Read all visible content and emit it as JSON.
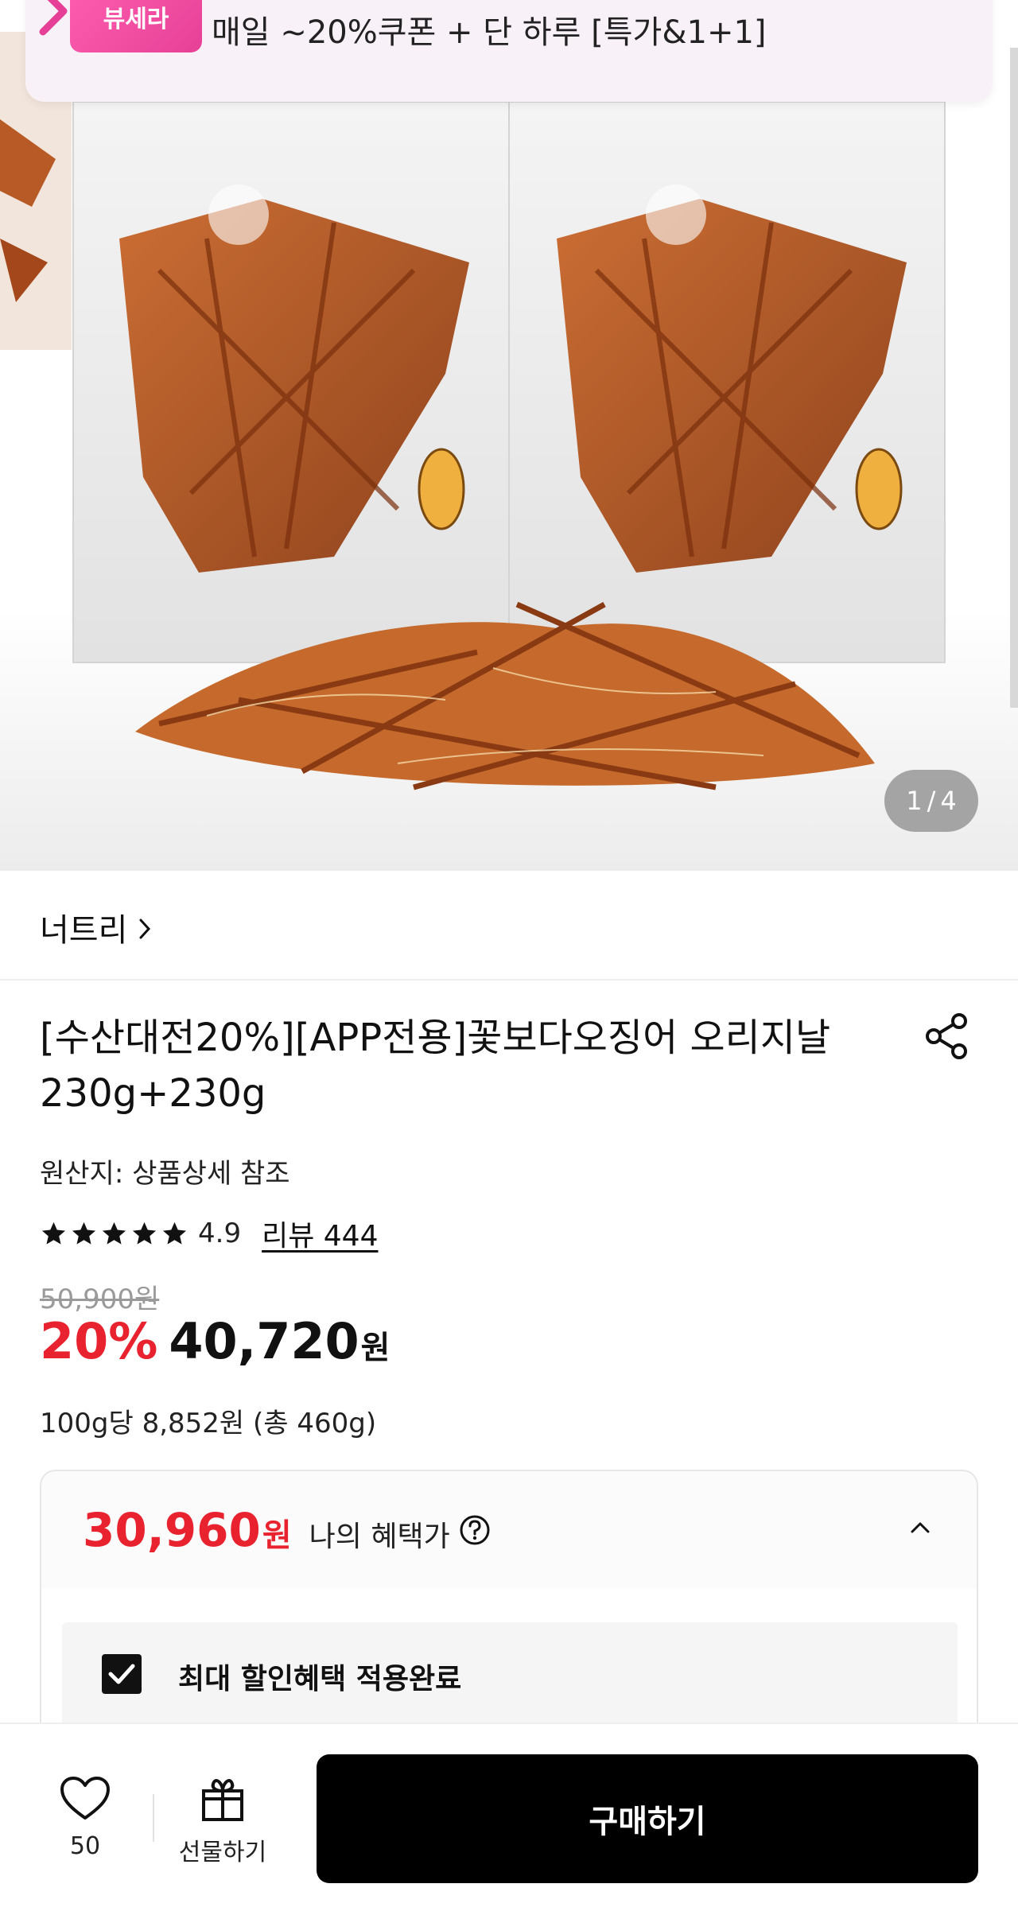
{
  "promo": {
    "badge": "뷰세라",
    "text": "매일 ~20%쿠폰 + 단 하루 [특가&1+1]",
    "arrow_icon": "chevron-right-icon",
    "accent": "#e64096"
  },
  "gallery": {
    "current": "1",
    "separator": "/",
    "total": "4"
  },
  "brand": {
    "name": "너트리"
  },
  "product": {
    "title": "[수산대전20%][APP전용]꽃보다오징어 오리지날 230g+230g",
    "origin": "원산지: 상품상세 참조",
    "rating": "4.9",
    "rating_stars": 5,
    "review_link": "리뷰 444",
    "original_price": "50,900원",
    "discount": "20%",
    "price": "40,720",
    "price_unit": "원",
    "unit_price": "100g당 8,852원 (총 460g)"
  },
  "benefit": {
    "price": "30,960",
    "price_unit": "원",
    "label": "나의 혜택가",
    "applied_label": "최대 할인혜택 적용완료",
    "accent": "#e8232f"
  },
  "bottom_bar": {
    "like_count": "50",
    "gift_label": "선물하기",
    "buy_label": "구매하기"
  }
}
